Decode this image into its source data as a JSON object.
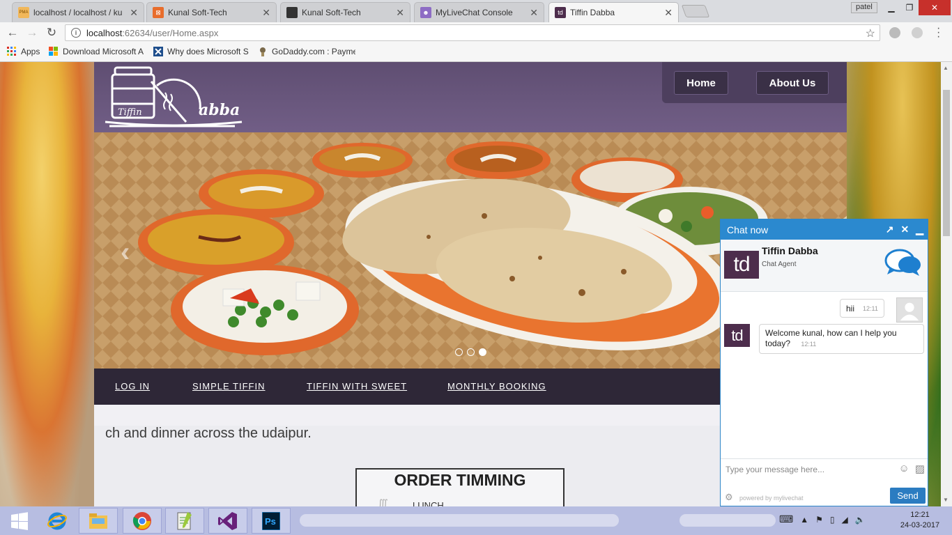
{
  "browser": {
    "tabs": [
      {
        "title": "localhost / localhost / ku",
        "favicon": "phpmyadmin-icon",
        "favicon_text": "PMA",
        "favicon_color": "#e8a33a"
      },
      {
        "title": "Kunal Soft-Tech",
        "favicon": "orange-app-icon",
        "favicon_color": "#e86d2c"
      },
      {
        "title": "Kunal Soft-Tech",
        "favicon": "dark-app-icon",
        "favicon_color": "#333333"
      },
      {
        "title": "MyLiveChat Console",
        "favicon": "users-icon",
        "favicon_color": "#7a5ab8"
      },
      {
        "title": "Tiffin Dabba",
        "favicon": "td-icon",
        "favicon_text": "td",
        "favicon_color": "#4d2d4c",
        "active": true
      }
    ],
    "profile": "patel",
    "url_host": "localhost",
    "url_rest": ":62634/user/Home.aspx",
    "bookmarks": [
      {
        "label": "Apps",
        "icon": "apps-grid-icon"
      },
      {
        "label": "Download Microsoft A",
        "icon": "microsoft-icon"
      },
      {
        "label": "Why does Microsoft S",
        "icon": "x-icon"
      },
      {
        "label": "GoDaddy.com : Payme",
        "icon": "godaddy-icon"
      }
    ]
  },
  "site": {
    "logo_text": "Tiffin Dabba",
    "top_nav": [
      "Home",
      "About Us"
    ],
    "sub_nav": [
      "LOG IN",
      "SIMPLE TIFFIN",
      "TIFFIN WITH SWEET",
      "MONTHLY BOOKING"
    ],
    "slider_dots": 3,
    "slider_active": 3,
    "lead_text": "ch and dinner across the udaipur.",
    "order_title": "ORDER TIMMING",
    "order_first_item": "LUNCH"
  },
  "chat": {
    "header_title": "Chat now",
    "agent_logo": "td",
    "agent_name": "Tiffin Dabba",
    "agent_role": "Chat Agent",
    "messages": [
      {
        "from": "visitor",
        "text": "hii",
        "time": "12:11"
      },
      {
        "from": "agent",
        "text": "Welcome kunal, how can I help you today?",
        "time": "12:11"
      }
    ],
    "input_placeholder": "Type your message here...",
    "powered_by": "powered by mylivechat",
    "send_label": "Send",
    "accent": "#2b89cf"
  },
  "taskbar": {
    "time": "12:21",
    "date": "24-03-2017"
  }
}
